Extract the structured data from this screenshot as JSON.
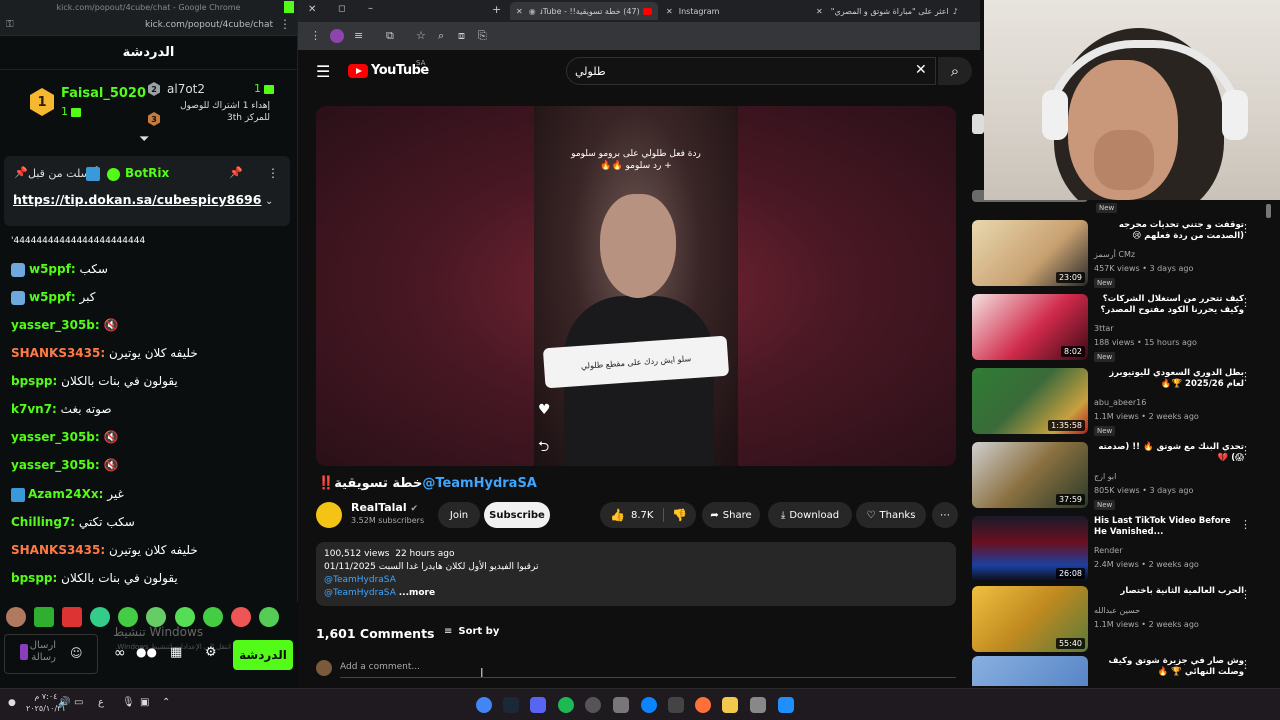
{
  "kick": {
    "window_title": "kick.com/popout/4cube/chat - Google Chrome",
    "url": "kick.com/popout/4cube/chat",
    "chat_title": "الدردشة",
    "leaderboard": [
      {
        "rank": "1",
        "name": "Faisal_5020",
        "count": "1"
      },
      {
        "rank": "2",
        "name": "al7ot2",
        "count": "1"
      },
      {
        "rank": "3",
        "text": "إهداء 1 اشتراك للوصول للمركز 3th"
      }
    ],
    "pinned": {
      "from_label": "أرسلت من قبل",
      "user": "BotRix",
      "link": "https://tip.dokan.sa/cubespicy8696"
    },
    "messages": [
      {
        "user": "",
        "text": "'44444444444444444444444",
        "color": "#ffffff"
      },
      {
        "user": "w5ppf:",
        "text": "سكب",
        "color": "#53fc18"
      },
      {
        "user": "w5ppf:",
        "text": "كبر",
        "color": "#53fc18"
      },
      {
        "user": "yasser_305b:",
        "text": "",
        "color": "#53fc18"
      },
      {
        "user": "SHANKS3435:",
        "text": "خليفه كلان يوتيرن",
        "color": "#ff7a45"
      },
      {
        "user": "bpspp:",
        "text": "يقولون في بنات بالكلان",
        "color": "#53fc18"
      },
      {
        "user": "k7vn7:",
        "text": "صوته بغث",
        "color": "#53fc18"
      },
      {
        "user": "yasser_305b:",
        "text": "",
        "color": "#53fc18"
      },
      {
        "user": "yasser_305b:",
        "text": "",
        "color": "#53fc18"
      },
      {
        "user": "Azam24Xx:",
        "text": "غير",
        "color": "#53fc18"
      },
      {
        "user": "Chilling7:",
        "text": "سكب تكتي",
        "color": "#53fc18"
      },
      {
        "user": "SHANKS3435:",
        "text": "خليفه كلان يوتيرن",
        "color": "#ff7a45"
      },
      {
        "user": "bpspp:",
        "text": "يقولون في بنات بالكلان",
        "color": "#53fc18"
      }
    ],
    "input_placeholder": "ارسال رسالة",
    "send_label": "الدردشة",
    "windows_watermark": "تنشيط Windows",
    "windows_sub": "انتقل إلى الإعدادات لتنشيط Windows."
  },
  "browser": {
    "tabs": [
      {
        "label": "(47) خطة تسويقية!! - YouTube"
      },
      {
        "label": "Instagram"
      },
      {
        "label": "اعثر على \"مباراة شوتق و المصري\""
      }
    ],
    "brand": "YouTube",
    "region": "SA",
    "search_value": "طلولي"
  },
  "video": {
    "overlay_title": "ردة فعل طلولي على برومو سلومو\n+ رد سلومو 🔥🔥",
    "bubble_text": "سلو ايش ردك على مقطع طلولي",
    "title_prefix": "‼️خطة تسويقية",
    "title_mention": "@TeamHydraSA",
    "channel": "RealTalal",
    "subs": "3.52M subscribers",
    "join": "Join",
    "subscribe": "Subscribe",
    "likes": "8.7K",
    "share": "Share",
    "download": "Download",
    "thanks": "Thanks",
    "views": "100,512 views",
    "ago": "22 hours ago",
    "desc_line": "ترقبوا الفيديو الأول لكلان هايدرا غدا السبت 01/11/2025",
    "desc_link1": "@TeamHydraSA",
    "desc_link2": "@TeamHydraSA",
    "more": "...more",
    "comments_count": "1,601 Comments",
    "sort_by": "Sort by",
    "add_comment": "Add a comment..."
  },
  "sidebar": [
    {
      "title": "توقفت و جتني تحديات محرجه (الصدمت من ردة فعلهم 😢",
      "channel": "أرسمز CMz",
      "meta": "457K views • 3 days ago",
      "dur": "23:09",
      "new": "New",
      "color": "#c8a070"
    },
    {
      "title": "كيف تتحرر من استغلال الشركات؟ وكيف يحررنا الكود مفتوح المصدر؟",
      "channel": "3ttar",
      "meta": "188 views • 15 hours ago",
      "dur": "8:02",
      "new": "New",
      "color": "#d02a4a"
    },
    {
      "title": "بطل الدوري السعودي لليوتيوبرز لعام 2025/26 🏆🔥",
      "channel": "abu_abeer16",
      "meta": "1.1M views • 2 weeks ago",
      "dur": "1:35:58",
      "new": "New",
      "color": "#3a6a3a"
    },
    {
      "title": "تحدي البنك مع شوتق 🔥 !! (صدمته 😱) 💔",
      "channel": "ابو ارج",
      "meta": "805K views • 3 days ago",
      "dur": "37:59",
      "new": "New",
      "color": "#8a7040"
    },
    {
      "title": "His Last TikTok Video Before He Vanished...",
      "channel": "Render",
      "meta": "2.4M views • 2 weeks ago",
      "dur": "26:08",
      "new": "",
      "color": "#6a1020"
    },
    {
      "title": "الحرب العالمية الثانية باختصار",
      "channel": "حسين عبدالله",
      "meta": "1.1M views • 2 weeks ago",
      "dur": "55:40",
      "new": "",
      "color": "#c08a20"
    },
    {
      "title": "وش صار في جزيرة شوتق وكيف وصلت النهائي 🏆 🔥",
      "channel": "",
      "meta": "",
      "dur": "",
      "new": "",
      "color": "#4a7ac0"
    }
  ],
  "taskbar": {
    "clock_time": "٧:٠٤ م",
    "clock_date": "٢٠٢٥/١٠/٣١",
    "lang": "ع"
  }
}
